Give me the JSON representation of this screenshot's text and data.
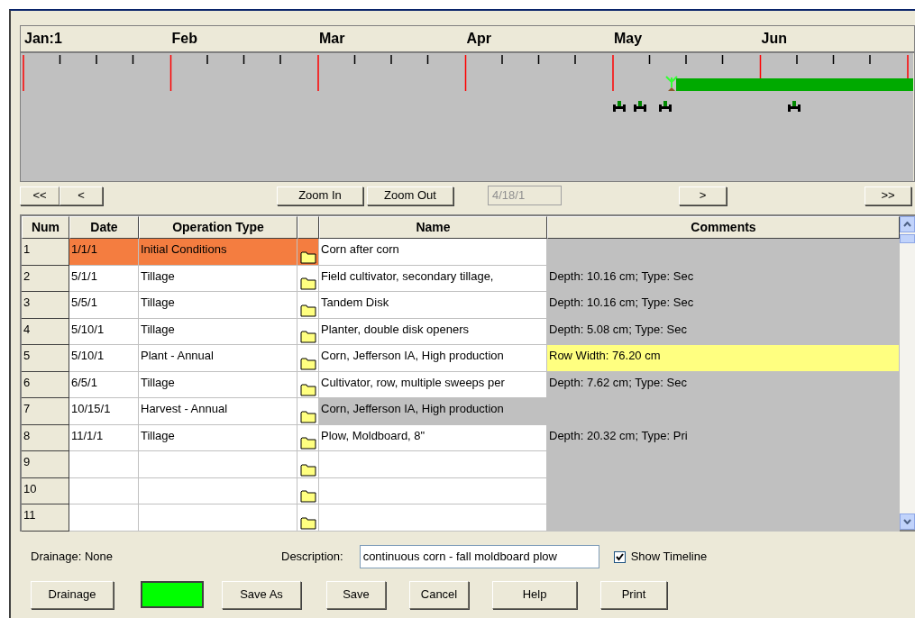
{
  "timeline": {
    "months": [
      "Jan:1",
      "Feb",
      "Mar",
      "Apr",
      "May",
      "Jun"
    ],
    "nav": {
      "first": "<<",
      "prev": "<",
      "zoom_in": "Zoom In",
      "zoom_out": "Zoom Out",
      "date": "4/18/1",
      "next": ">",
      "last": ">>"
    }
  },
  "table": {
    "columns": [
      "Num",
      "Date",
      "Operation Type",
      "Name",
      "Comments"
    ],
    "rows": [
      {
        "num": "1",
        "date": "1/1/1",
        "type": "Initial Conditions",
        "name": "Corn after corn",
        "comment": "",
        "selected": true,
        "comment_highlighted": false,
        "name_greyed": false
      },
      {
        "num": "2",
        "date": "5/1/1",
        "type": "Tillage",
        "name": "Field cultivator, secondary tillage,",
        "comment": "Depth: 10.16 cm; Type: Sec",
        "selected": false,
        "comment_highlighted": false,
        "name_greyed": false
      },
      {
        "num": "3",
        "date": "5/5/1",
        "type": "Tillage",
        "name": "Tandem Disk",
        "comment": "Depth: 10.16 cm; Type: Sec",
        "selected": false,
        "comment_highlighted": false,
        "name_greyed": false
      },
      {
        "num": "4",
        "date": "5/10/1",
        "type": "Tillage",
        "name": "Planter, double disk openers",
        "comment": "Depth: 5.08 cm; Type: Sec",
        "selected": false,
        "comment_highlighted": false,
        "name_greyed": false
      },
      {
        "num": "5",
        "date": "5/10/1",
        "type": "Plant - Annual",
        "name": "Corn, Jefferson IA, High production",
        "comment": "Row Width: 76.20 cm",
        "selected": false,
        "comment_highlighted": true,
        "name_greyed": false
      },
      {
        "num": "6",
        "date": "6/5/1",
        "type": "Tillage",
        "name": "Cultivator, row, multiple sweeps per",
        "comment": "Depth: 7.62 cm; Type: Sec",
        "selected": false,
        "comment_highlighted": false,
        "name_greyed": false
      },
      {
        "num": "7",
        "date": "10/15/1",
        "type": "Harvest - Annual",
        "name": "Corn, Jefferson IA, High production",
        "comment": "",
        "selected": false,
        "comment_highlighted": false,
        "name_greyed": true
      },
      {
        "num": "8",
        "date": "11/1/1",
        "type": "Tillage",
        "name": "Plow, Moldboard, 8\"",
        "comment": "Depth: 20.32 cm; Type: Pri",
        "selected": false,
        "comment_highlighted": false,
        "name_greyed": false
      },
      {
        "num": "9",
        "date": "",
        "type": "",
        "name": "",
        "comment": "",
        "selected": false,
        "comment_highlighted": false,
        "name_greyed": false
      },
      {
        "num": "10",
        "date": "",
        "type": "",
        "name": "",
        "comment": "",
        "selected": false,
        "comment_highlighted": false,
        "name_greyed": false
      },
      {
        "num": "11",
        "date": "",
        "type": "",
        "name": "",
        "comment": "",
        "selected": false,
        "comment_highlighted": false,
        "name_greyed": false
      }
    ]
  },
  "drainage_label": "Drainage: None",
  "description": {
    "label": "Description:",
    "value": "continuous corn - fall moldboard plow"
  },
  "show_timeline": {
    "label": "Show Timeline",
    "checked": true
  },
  "color_swatch": {
    "color": "#00ff00"
  },
  "buttons": [
    "Drainage",
    "Save As",
    "Save",
    "Cancel",
    "Help",
    "Print"
  ]
}
